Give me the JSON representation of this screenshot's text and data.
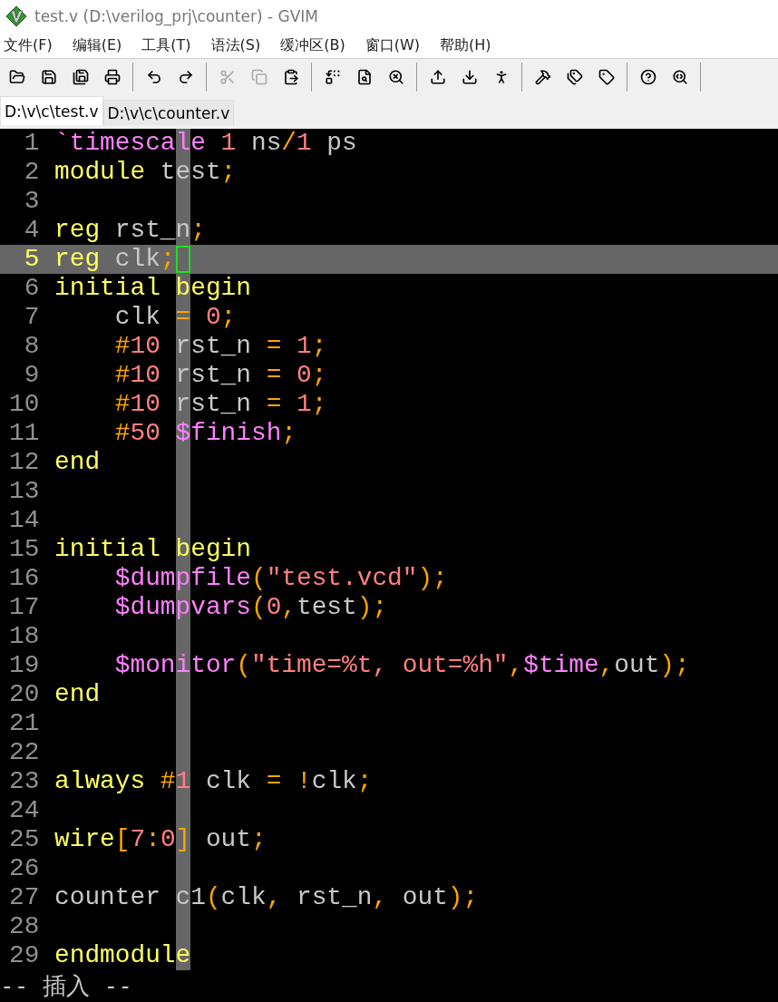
{
  "window": {
    "title": "test.v (D:\\verilog_prj\\counter) - GVIM"
  },
  "menu": [
    "文件(F)",
    "编辑(E)",
    "工具(T)",
    "语法(S)",
    "缓冲区(B)",
    "窗口(W)",
    "帮助(H)"
  ],
  "toolbar": [
    [
      {
        "kind": "open",
        "disabled": false
      },
      {
        "kind": "save",
        "disabled": false
      },
      {
        "kind": "saveall",
        "disabled": false
      },
      {
        "kind": "print",
        "disabled": false
      }
    ],
    [
      {
        "kind": "undo",
        "disabled": false
      },
      {
        "kind": "redo",
        "disabled": false
      }
    ],
    [
      {
        "kind": "cut",
        "disabled": true
      },
      {
        "kind": "copy",
        "disabled": true
      },
      {
        "kind": "paste",
        "disabled": false
      }
    ],
    [
      {
        "kind": "replace",
        "disabled": false
      },
      {
        "kind": "findnext",
        "disabled": false
      },
      {
        "kind": "findprev",
        "disabled": false
      }
    ],
    [
      {
        "kind": "loadsession",
        "disabled": false
      },
      {
        "kind": "savesession",
        "disabled": false
      },
      {
        "kind": "runscript",
        "disabled": false
      }
    ],
    [
      {
        "kind": "make",
        "disabled": false
      },
      {
        "kind": "maketags",
        "disabled": false
      },
      {
        "kind": "tag",
        "disabled": false
      }
    ],
    [
      {
        "kind": "help",
        "disabled": false
      },
      {
        "kind": "findhelp",
        "disabled": false
      }
    ]
  ],
  "tabs": [
    {
      "label": "D:\\v\\c\\test.v",
      "selected": true
    },
    {
      "label": "D:\\v\\c\\counter.v",
      "selected": false
    }
  ],
  "lines": [
    {
      "number": "1",
      "current": false,
      "tokens": [
        {
          "text": "`timescale",
          "kind": "directive"
        },
        {
          "text": " 1",
          "kind": "number"
        },
        {
          "text": " ns",
          "kind": "ident"
        },
        {
          "text": "/",
          "kind": "op"
        },
        {
          "text": "1",
          "kind": "number"
        },
        {
          "text": " ps",
          "kind": "ident"
        }
      ]
    },
    {
      "number": "2",
      "current": false,
      "tokens": [
        {
          "text": "module",
          "kind": "keyword"
        },
        {
          "text": " test",
          "kind": "ident"
        },
        {
          "text": ";",
          "kind": "op"
        }
      ]
    },
    {
      "number": "3",
      "current": false
    },
    {
      "number": "4",
      "current": false,
      "tokens": [
        {
          "text": "reg",
          "kind": "keyword"
        },
        {
          "text": " rst_n",
          "kind": "ident"
        },
        {
          "text": ";",
          "kind": "op"
        }
      ]
    },
    {
      "number": "5",
      "current": true,
      "tokens": [
        {
          "text": "reg",
          "kind": "keyword"
        },
        {
          "text": " clk",
          "kind": "ident"
        },
        {
          "text": ";",
          "kind": "op"
        }
      ]
    },
    {
      "number": "6",
      "current": false,
      "tokens": [
        {
          "text": "initial begin",
          "kind": "keyword"
        }
      ]
    },
    {
      "number": "7",
      "current": false,
      "tokens": [
        {
          "text": "    clk",
          "kind": "ident"
        },
        {
          "text": " =",
          "kind": "op"
        },
        {
          "text": " 0",
          "kind": "number"
        },
        {
          "text": ";",
          "kind": "op"
        }
      ]
    },
    {
      "number": "8",
      "current": false,
      "tokens": [
        {
          "text": "    #",
          "kind": "op"
        },
        {
          "text": "10",
          "kind": "number"
        },
        {
          "text": " rst_n",
          "kind": "ident"
        },
        {
          "text": " =",
          "kind": "op"
        },
        {
          "text": " 1",
          "kind": "number"
        },
        {
          "text": ";",
          "kind": "op"
        }
      ]
    },
    {
      "number": "9",
      "current": false,
      "tokens": [
        {
          "text": "    #",
          "kind": "op"
        },
        {
          "text": "10",
          "kind": "number"
        },
        {
          "text": " rst_n",
          "kind": "ident"
        },
        {
          "text": " =",
          "kind": "op"
        },
        {
          "text": " 0",
          "kind": "number"
        },
        {
          "text": ";",
          "kind": "op"
        }
      ]
    },
    {
      "number": "10",
      "current": false,
      "tokens": [
        {
          "text": "    #",
          "kind": "op"
        },
        {
          "text": "10",
          "kind": "number"
        },
        {
          "text": " rst_n",
          "kind": "ident"
        },
        {
          "text": " =",
          "kind": "op"
        },
        {
          "text": " 1",
          "kind": "number"
        },
        {
          "text": ";",
          "kind": "op"
        }
      ]
    },
    {
      "number": "11",
      "current": false,
      "tokens": [
        {
          "text": "    #",
          "kind": "op"
        },
        {
          "text": "50",
          "kind": "number"
        },
        {
          "text": " $finish",
          "kind": "system"
        },
        {
          "text": ";",
          "kind": "op"
        }
      ]
    },
    {
      "number": "12",
      "current": false,
      "tokens": [
        {
          "text": "end",
          "kind": "keyword"
        }
      ]
    },
    {
      "number": "13",
      "current": false
    },
    {
      "number": "14",
      "current": false
    },
    {
      "number": "15",
      "current": false,
      "tokens": [
        {
          "text": "initial begin",
          "kind": "keyword"
        }
      ]
    },
    {
      "number": "16",
      "current": false,
      "tokens": [
        {
          "text": "    $dumpfile",
          "kind": "system"
        },
        {
          "text": "(",
          "kind": "op"
        },
        {
          "text": "\"test.vcd\"",
          "kind": "string"
        },
        {
          "text": ");",
          "kind": "op"
        }
      ]
    },
    {
      "number": "17",
      "current": false,
      "tokens": [
        {
          "text": "    $dumpvars",
          "kind": "system"
        },
        {
          "text": "(",
          "kind": "op"
        },
        {
          "text": "0",
          "kind": "number"
        },
        {
          "text": ",",
          "kind": "op"
        },
        {
          "text": "test",
          "kind": "ident"
        },
        {
          "text": ");",
          "kind": "op"
        }
      ]
    },
    {
      "number": "18",
      "current": false
    },
    {
      "number": "19",
      "current": false,
      "tokens": [
        {
          "text": "    $monitor",
          "kind": "system"
        },
        {
          "text": "(",
          "kind": "op"
        },
        {
          "text": "\"time=%t, out=%h\"",
          "kind": "string"
        },
        {
          "text": ",",
          "kind": "op"
        },
        {
          "text": "$time",
          "kind": "system"
        },
        {
          "text": ",",
          "kind": "op"
        },
        {
          "text": "out",
          "kind": "ident"
        },
        {
          "text": ");",
          "kind": "op"
        }
      ]
    },
    {
      "number": "20",
      "current": false,
      "tokens": [
        {
          "text": "end",
          "kind": "keyword"
        }
      ]
    },
    {
      "number": "21",
      "current": false
    },
    {
      "number": "22",
      "current": false
    },
    {
      "number": "23",
      "current": false,
      "tokens": [
        {
          "text": "always",
          "kind": "keyword"
        },
        {
          "text": " #",
          "kind": "op"
        },
        {
          "text": "1",
          "kind": "number"
        },
        {
          "text": " clk",
          "kind": "ident"
        },
        {
          "text": " =",
          "kind": "op"
        },
        {
          "text": " !",
          "kind": "op"
        },
        {
          "text": "clk",
          "kind": "ident"
        },
        {
          "text": ";",
          "kind": "op"
        }
      ]
    },
    {
      "number": "24",
      "current": false
    },
    {
      "number": "25",
      "current": false,
      "tokens": [
        {
          "text": "wire",
          "kind": "keyword"
        },
        {
          "text": "[",
          "kind": "op"
        },
        {
          "text": "7",
          "kind": "number"
        },
        {
          "text": ":",
          "kind": "op"
        },
        {
          "text": "0",
          "kind": "number"
        },
        {
          "text": "]",
          "kind": "op"
        },
        {
          "text": " out",
          "kind": "ident"
        },
        {
          "text": ";",
          "kind": "op"
        }
      ]
    },
    {
      "number": "26",
      "current": false
    },
    {
      "number": "27",
      "current": false,
      "tokens": [
        {
          "text": "counter",
          "kind": "ident"
        },
        {
          "text": " c1",
          "kind": "ident"
        },
        {
          "text": "(",
          "kind": "op"
        },
        {
          "text": "clk",
          "kind": "ident"
        },
        {
          "text": ",",
          "kind": "op"
        },
        {
          "text": " rst_n",
          "kind": "ident"
        },
        {
          "text": ",",
          "kind": "op"
        },
        {
          "text": " out",
          "kind": "ident"
        },
        {
          "text": ");",
          "kind": "op"
        }
      ]
    },
    {
      "number": "28",
      "current": false
    },
    {
      "number": "29",
      "current": false,
      "tokens": [
        {
          "text": "endmodule",
          "kind": "keyword"
        }
      ]
    }
  ],
  "mode_line": "-- 插入 --"
}
